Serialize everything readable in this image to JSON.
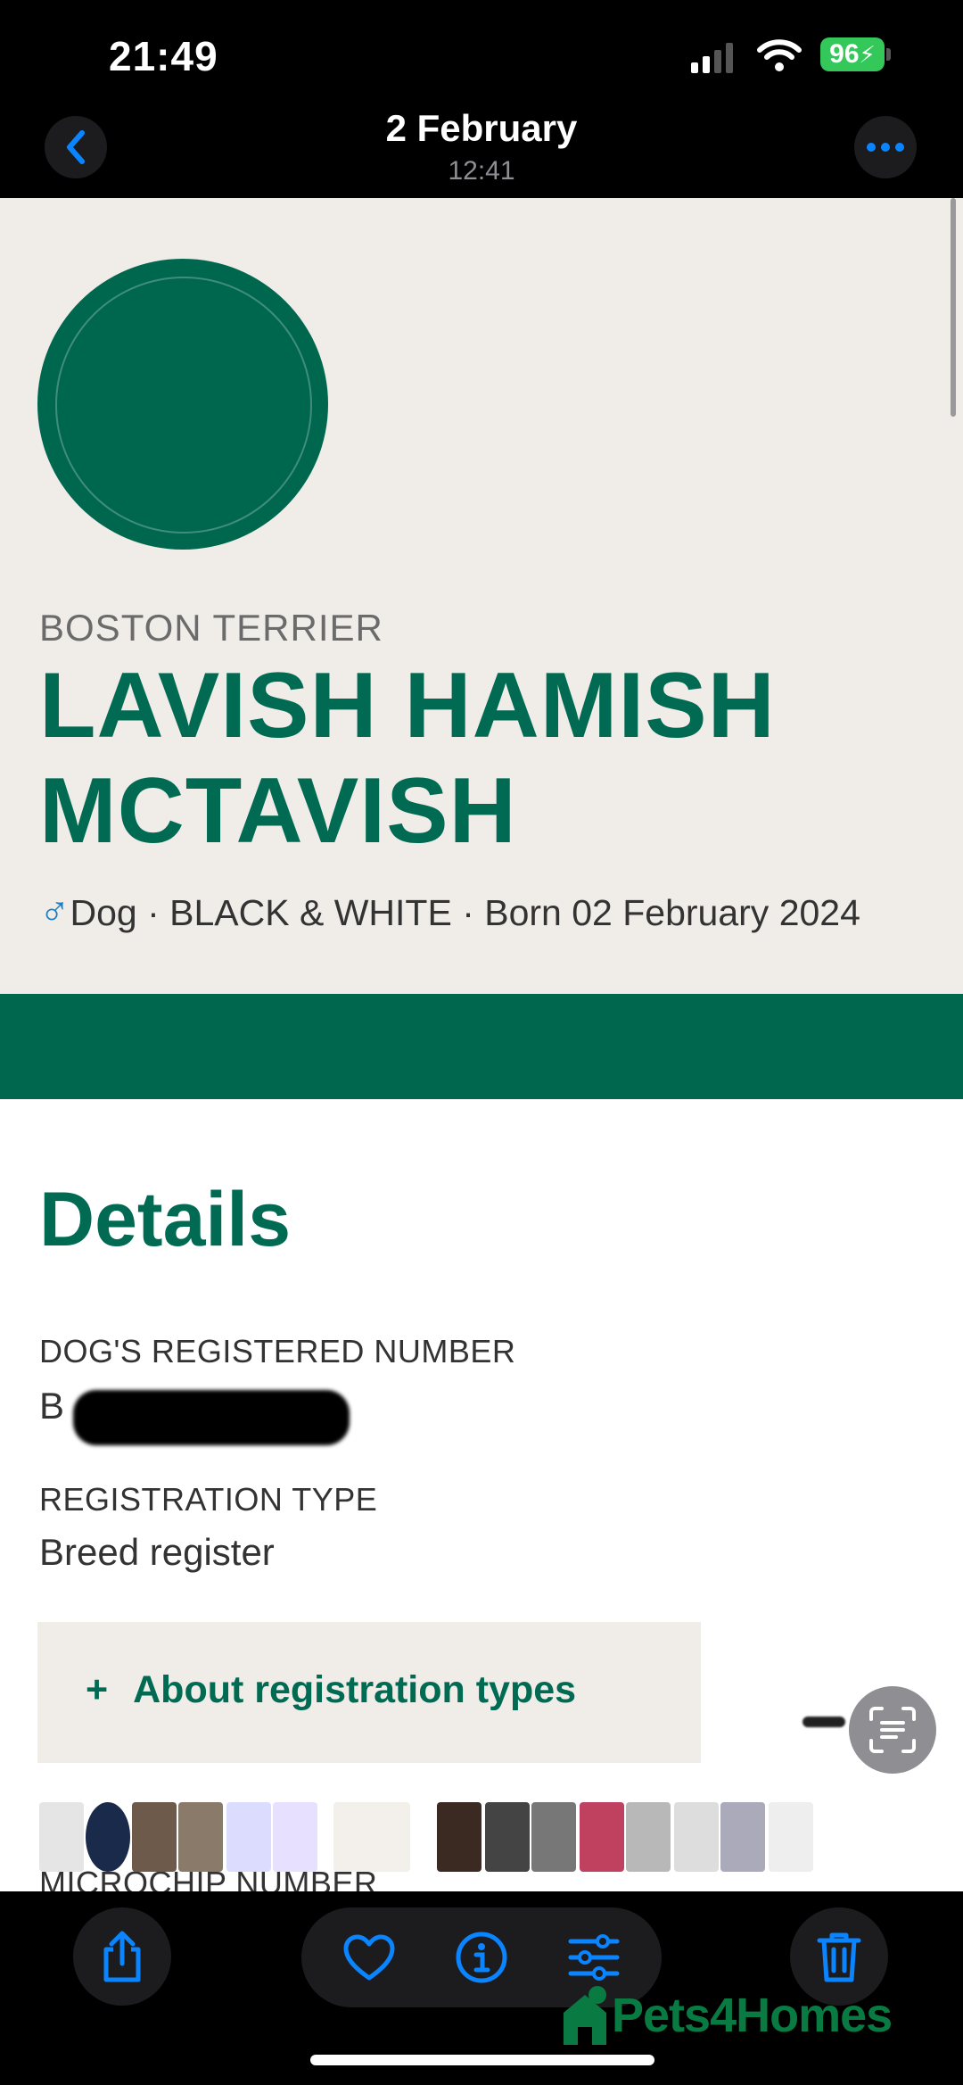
{
  "status_bar": {
    "time": "21:49",
    "battery": "96"
  },
  "nav": {
    "title": "2 February",
    "subtitle": "12:41"
  },
  "pet": {
    "breed": "BOSTON TERRIER",
    "name": "LAVISH HAMISH MCTAVISH",
    "sex_symbol": "♂",
    "summary": "Dog · BLACK & WHITE · Born 02 February 2024"
  },
  "details": {
    "heading": "Details",
    "registered_number_label": "DOG'S REGISTERED NUMBER",
    "registered_number_value": "B",
    "registration_type_label": "REGISTRATION TYPE",
    "registration_type_value": "Breed register",
    "about_plus": "+",
    "about_label": "About registration types",
    "microchip_label": "MICROCHIP NUMBER"
  },
  "watermark": "Pets4Homes",
  "colors": {
    "brand_green": "#00674f",
    "hero_bg": "#f0ede9",
    "ios_blue": "#0a84ff"
  },
  "icons": [
    "back-chevron-icon",
    "more-icon",
    "text-scan-icon",
    "share-icon",
    "heart-icon",
    "info-icon",
    "adjust-icon",
    "trash-icon"
  ]
}
